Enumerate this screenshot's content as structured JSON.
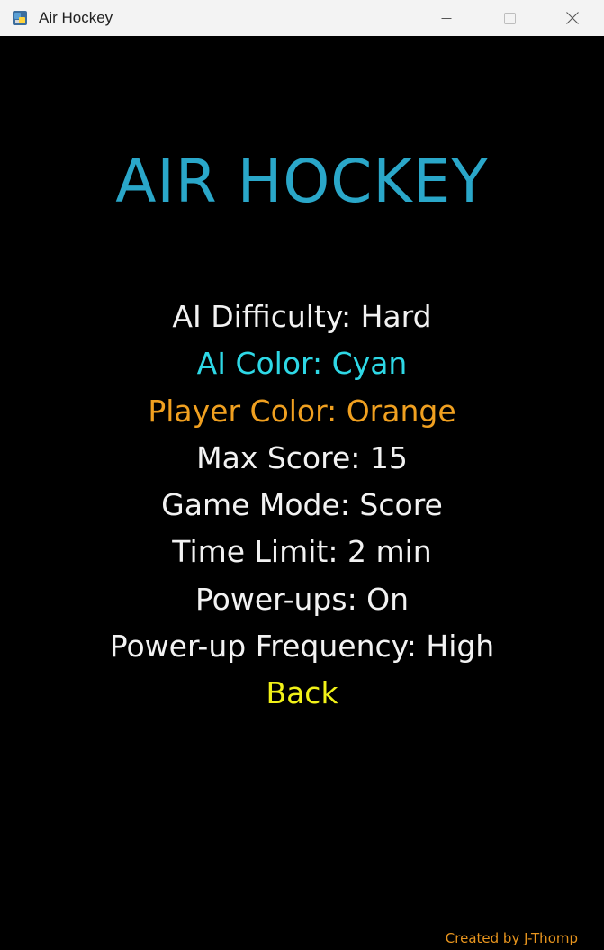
{
  "window": {
    "title": "Air Hockey",
    "app_icon": "python-icon",
    "controls": [
      "minimize-icon",
      "maximize-icon",
      "close-icon"
    ]
  },
  "game": {
    "title": "AIR HOCKEY",
    "title_color": "#2aa7c9",
    "menu": [
      {
        "label": "AI Difficulty: Hard",
        "color": "#f2f2f2"
      },
      {
        "label": "AI Color: Cyan",
        "color": "#2ed8e6"
      },
      {
        "label": "Player Color: Orange",
        "color": "#f0a020"
      },
      {
        "label": "Max Score: 15",
        "color": "#f2f2f2"
      },
      {
        "label": "Game Mode: Score",
        "color": "#f2f2f2"
      },
      {
        "label": "Time Limit: 2 min",
        "color": "#f2f2f2"
      },
      {
        "label": "Power-ups: On",
        "color": "#f2f2f2"
      },
      {
        "label": "Power-up Frequency: High",
        "color": "#f2f2f2"
      },
      {
        "label": "Back",
        "color": "#f2f218"
      }
    ],
    "credit": "Created by J-Thomp",
    "credit_color": "#e8951e"
  }
}
